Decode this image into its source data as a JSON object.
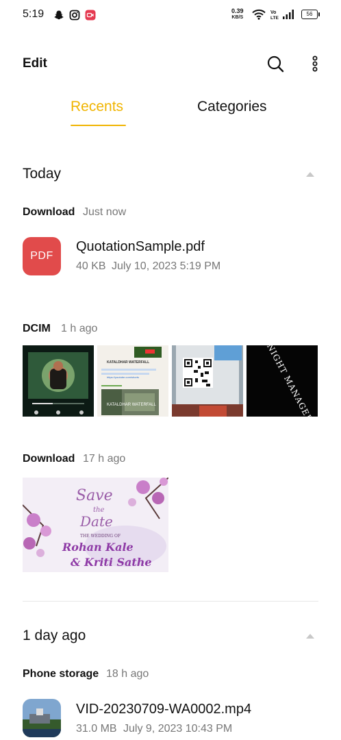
{
  "status_bar": {
    "time": "5:19",
    "net_speed": "0.39",
    "net_unit": "KB/S",
    "battery": "56",
    "icons": [
      "snapchat-icon",
      "instagram-icon",
      "screen-recorder-icon",
      "wifi-icon",
      "volte-icon",
      "signal-icon",
      "battery-icon"
    ]
  },
  "header": {
    "edit_label": "Edit",
    "icons": [
      "search-icon",
      "more-options-icon"
    ]
  },
  "tabs": [
    {
      "label": "Recents",
      "active": true
    },
    {
      "label": "Categories",
      "active": false
    }
  ],
  "accent_color": "#f0b400",
  "sections": [
    {
      "title": "Today",
      "groups": [
        {
          "source": "Download",
          "time": "Just now",
          "files": [
            {
              "icon_label": "PDF",
              "name": "QuotationSample.pdf",
              "size": "40 KB",
              "date": "July 10, 2023 5:19 PM"
            }
          ]
        },
        {
          "source": "DCIM",
          "time": "1 h ago",
          "thumbnails": [
            {
              "kind": "music-player-screenshot"
            },
            {
              "kind": "whatsapp-chat-screenshot",
              "text_lines": [
                "KATALDHAR WATERFALL",
                "https://youtube.com/shorts"
              ],
              "caption": "KATALDHAR WATERFALL"
            },
            {
              "kind": "qr-code-photo"
            },
            {
              "kind": "title-card",
              "text": "NIGHT MANAGER"
            }
          ]
        },
        {
          "source": "Download",
          "time": "17 h ago",
          "thumbnails": [
            {
              "kind": "wedding-invite",
              "line1": "Save",
              "line2": "the",
              "line3": "Date",
              "line4": "THE WEDDING OF",
              "line5": "Rohan Kale",
              "line6": "& Kriti Sathe"
            }
          ]
        }
      ]
    },
    {
      "title": "1 day ago",
      "groups": [
        {
          "source": "Phone storage",
          "time": "18 h ago",
          "files": [
            {
              "name": "VID-20230709-WA0002.mp4",
              "size": "31.0 MB",
              "date": "July 9, 2023 10:43 PM"
            }
          ]
        }
      ]
    }
  ]
}
